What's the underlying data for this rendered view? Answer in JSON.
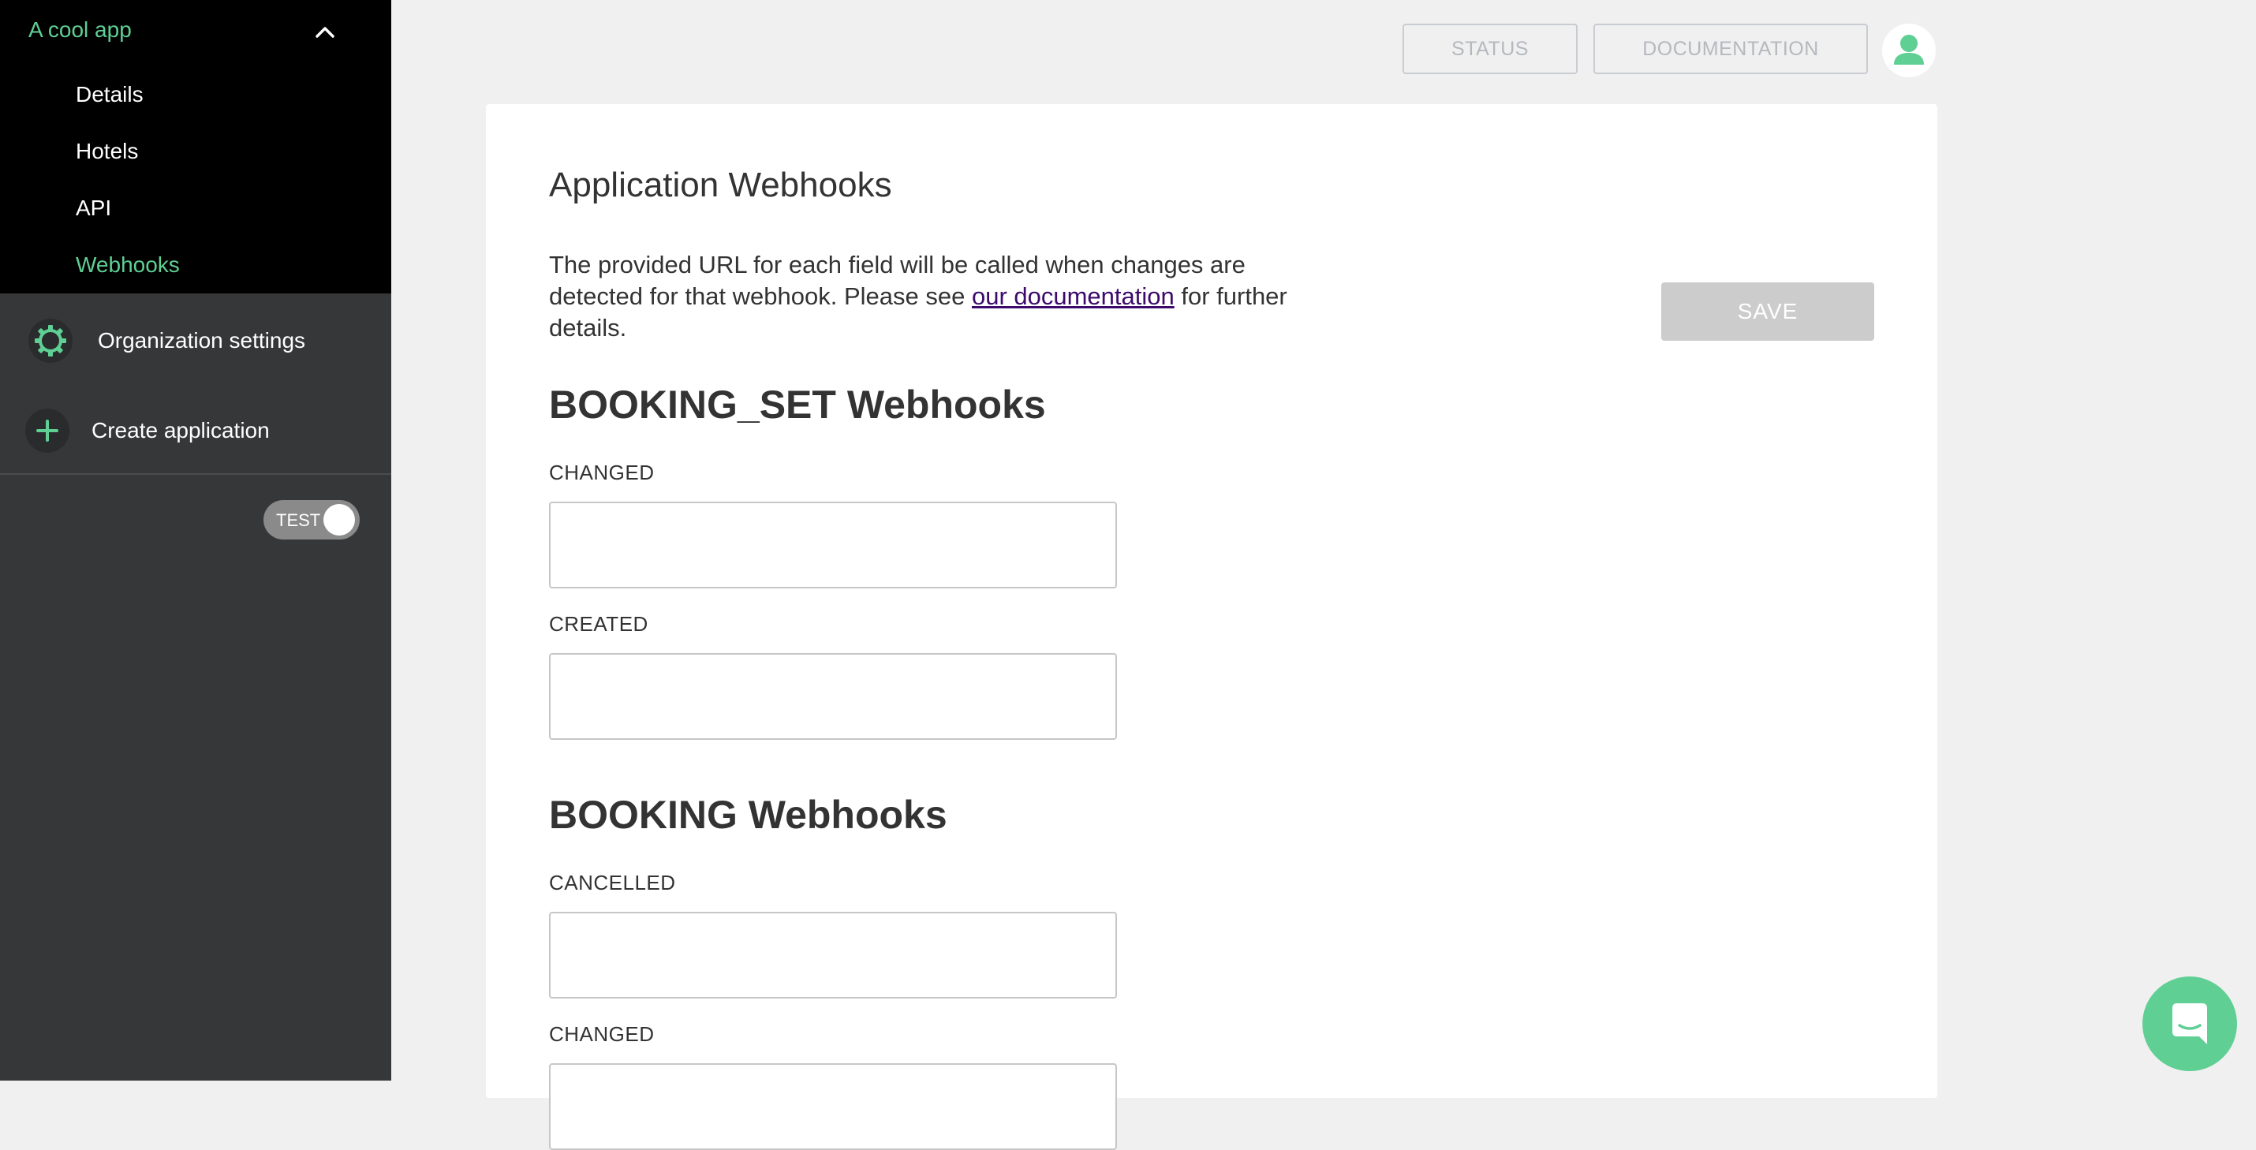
{
  "sidebar": {
    "app_title": "A cool app",
    "sub_items": [
      {
        "label": "Details"
      },
      {
        "label": "Hotels"
      },
      {
        "label": "API"
      },
      {
        "label": "Webhooks",
        "active": true
      }
    ],
    "org_settings_label": "Organization settings",
    "create_app_label": "Create application",
    "toggle_label": "TEST"
  },
  "topbar": {
    "status_label": "STATUS",
    "documentation_label": "DOCUMENTATION"
  },
  "main": {
    "title": "Application Webhooks",
    "description_before": "The provided URL for each field will be called when changes are detected for that webhook. Please see ",
    "description_link": "our documentation",
    "description_after": " for further details.",
    "save_label": "SAVE",
    "sections": [
      {
        "title": "BOOKING_SET Webhooks",
        "fields": [
          {
            "label": "CHANGED",
            "value": ""
          },
          {
            "label": "CREATED",
            "value": ""
          }
        ]
      },
      {
        "title": "BOOKING Webhooks",
        "fields": [
          {
            "label": "CANCELLED",
            "value": ""
          },
          {
            "label": "CHANGED",
            "value": ""
          }
        ]
      }
    ]
  },
  "colors": {
    "accent": "#5fcf94",
    "sidebar_bg": "#363738",
    "app_block_bg": "#000000",
    "page_bg": "#f0f0f0",
    "save_disabled": "#cccccc"
  },
  "icons": {
    "app_chevron": "chevron-up-icon",
    "org_settings": "gear-icon",
    "create_app": "plus-icon",
    "account": "user-icon",
    "chat": "chat-icon"
  }
}
